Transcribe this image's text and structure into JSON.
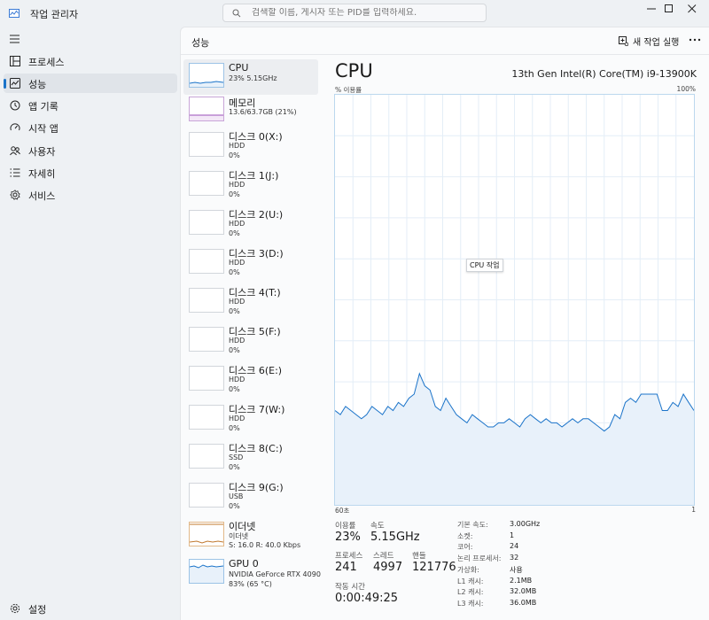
{
  "window": {
    "title": "작업 관리자",
    "search_placeholder": "검색할 이름, 게시자 또는 PID를 입력하세요."
  },
  "sidebar": {
    "items": [
      {
        "label": "프로세스",
        "icon": "processes-icon"
      },
      {
        "label": "성능",
        "icon": "performance-icon",
        "active": true
      },
      {
        "label": "앱 기록",
        "icon": "app-history-icon"
      },
      {
        "label": "시작 앱",
        "icon": "startup-apps-icon"
      },
      {
        "label": "사용자",
        "icon": "users-icon"
      },
      {
        "label": "자세히",
        "icon": "details-icon"
      },
      {
        "label": "서비스",
        "icon": "services-icon"
      }
    ],
    "settings_label": "설정"
  },
  "header": {
    "title": "성능",
    "new_task_label": "새 작업 실행"
  },
  "devices": [
    {
      "name": "CPU",
      "sub1": "23%  5.15GHz",
      "sub2": "",
      "kind": "cpu"
    },
    {
      "name": "메모리",
      "sub1": "13.6/63.7GB (21%)",
      "sub2": "",
      "kind": "mem"
    },
    {
      "name": "디스크 0(X:)",
      "sub1": "HDD",
      "sub2": "0%",
      "kind": "disk"
    },
    {
      "name": "디스크 1(J:)",
      "sub1": "HDD",
      "sub2": "0%",
      "kind": "disk"
    },
    {
      "name": "디스크 2(U:)",
      "sub1": "HDD",
      "sub2": "0%",
      "kind": "disk"
    },
    {
      "name": "디스크 3(D:)",
      "sub1": "HDD",
      "sub2": "0%",
      "kind": "disk"
    },
    {
      "name": "디스크 4(T:)",
      "sub1": "HDD",
      "sub2": "0%",
      "kind": "disk"
    },
    {
      "name": "디스크 5(F:)",
      "sub1": "HDD",
      "sub2": "0%",
      "kind": "disk"
    },
    {
      "name": "디스크 6(E:)",
      "sub1": "HDD",
      "sub2": "0%",
      "kind": "disk"
    },
    {
      "name": "디스크 7(W:)",
      "sub1": "HDD",
      "sub2": "0%",
      "kind": "disk"
    },
    {
      "name": "디스크 8(C:)",
      "sub1": "SSD",
      "sub2": "0%",
      "kind": "disk"
    },
    {
      "name": "디스크 9(G:)",
      "sub1": "USB",
      "sub2": "0%",
      "kind": "disk"
    },
    {
      "name": "이더넷",
      "sub1": "이더넷",
      "sub2": "S: 16.0  R: 40.0 Kbps",
      "kind": "net"
    },
    {
      "name": "GPU 0",
      "sub1": "NVIDIA GeForce RTX 4090",
      "sub2": "83% (65 °C)",
      "kind": "gpu"
    }
  ],
  "cpu": {
    "title": "CPU",
    "model": "13th Gen Intel(R) Core(TM) i9-13900K",
    "util_label": "% 이용률",
    "util_max": "100%",
    "tooltip": "CPU 작업",
    "axis_left": "60초",
    "axis_right": "1",
    "stats": {
      "util_label": "이용률",
      "util_value": "23%",
      "speed_label": "속도",
      "speed_value": "5.15GHz",
      "proc_label": "프로세스",
      "proc_value": "241",
      "thread_label": "스레드",
      "thread_value": "4997",
      "handle_label": "핸들",
      "handle_value": "121776",
      "uptime_label": "작동 시간",
      "uptime_value": "0:00:49:25"
    },
    "specs": [
      {
        "label": "기본 속도:",
        "value": "3.00GHz"
      },
      {
        "label": "소켓:",
        "value": "1"
      },
      {
        "label": "코어:",
        "value": "24"
      },
      {
        "label": "논리 프로세서:",
        "value": "32"
      },
      {
        "label": "가상화:",
        "value": "사용"
      },
      {
        "label": "L1 캐시:",
        "value": "2.1MB"
      },
      {
        "label": "L2 캐시:",
        "value": "32.0MB"
      },
      {
        "label": "L3 캐시:",
        "value": "36.0MB"
      }
    ],
    "history": [
      23,
      22,
      24,
      23,
      22,
      21,
      22,
      24,
      23,
      22,
      24,
      23,
      25,
      24,
      26,
      27,
      32,
      29,
      28,
      24,
      23,
      26,
      24,
      22,
      21,
      20,
      22,
      21,
      20,
      19,
      19,
      20,
      20,
      21,
      20,
      19,
      21,
      22,
      21,
      20,
      21,
      20,
      20,
      19,
      20,
      21,
      20,
      21,
      21,
      20,
      19,
      18,
      19,
      22,
      21,
      25,
      26,
      25,
      27,
      27,
      27,
      27,
      23,
      23,
      25,
      24,
      27,
      25,
      23
    ],
    "accent": "#1a73c9",
    "fill": "#e8f1fa"
  }
}
